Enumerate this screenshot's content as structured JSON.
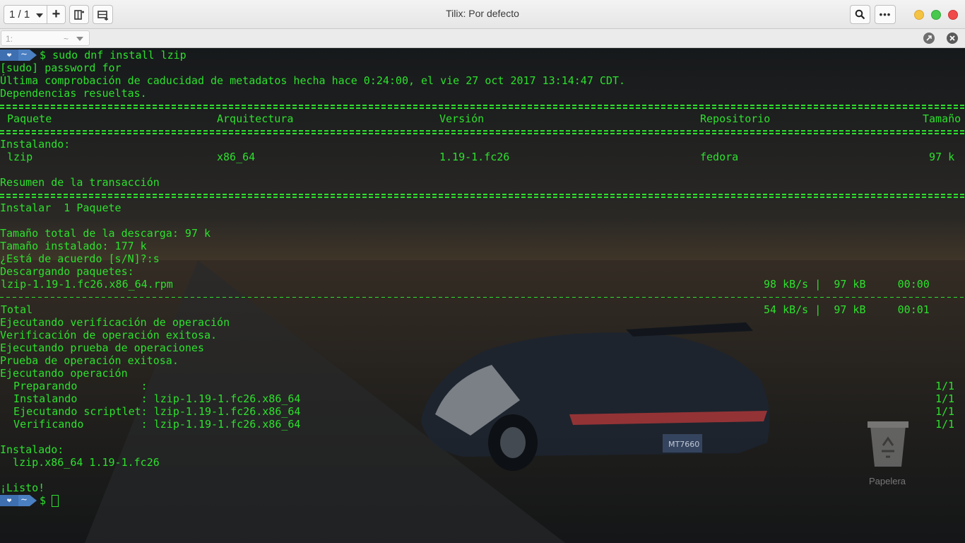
{
  "titlebar": {
    "session_label": "1 / 1",
    "add_label": "+",
    "window_title": "Tilix: Por defecto",
    "menu_label": "•••"
  },
  "terminal_bar": {
    "terminal_number": "1:",
    "terminal_path": "~"
  },
  "prompt": {
    "heart": "❤",
    "path": "~",
    "symbol": "$"
  },
  "output": {
    "cmd1": "sudo dnf install lzip",
    "l_sudo": "[sudo] password for",
    "l_meta": "Última comprobación de caducidad de metadatos hecha hace 0:24:00, el vie 27 oct 2017 13:14:47 CDT.",
    "l_deps": "Dependencias resueltas.",
    "h_pkg": " Paquete",
    "h_arch": "Arquitectura",
    "h_ver": "Versión",
    "h_repo": "Repositorio",
    "h_size": "Tamaño",
    "l_installing": "Instalando:",
    "r_pkg": " lzip",
    "r_arch": "x86_64",
    "r_ver": "1.19-1.fc26",
    "r_repo": "fedora",
    "r_size": "97 k",
    "l_summary": "Resumen de la transacción",
    "l_install1": "Instalar  1 Paquete",
    "l_dl_total": "Tamaño total de la descarga: 97 k",
    "l_installed_size": "Tamaño instalado: 177 k",
    "l_agree": "¿Está de acuerdo [s/N]?:s",
    "l_downloading": "Descargando paquetes:",
    "dl_file": "lzip-1.19-1.fc26.x86_64.rpm",
    "dl_stats": "98 kB/s |  97 kB     00:00",
    "total_label": "Total",
    "total_stats": "54 kB/s |  97 kB     00:01",
    "l_verif_run": "Ejecutando verificación de operación",
    "l_verif_ok": "Verificación de operación exitosa.",
    "l_test_run": "Ejecutando prueba de operaciones",
    "l_test_ok": "Prueba de operación exitosa.",
    "l_op_run": "Ejecutando operación",
    "s_prep": "  Preparando          :",
    "s_inst": "  Instalando          : lzip-1.19-1.fc26.x86_64",
    "s_script": "  Ejecutando scriptlet: lzip-1.19-1.fc26.x86_64",
    "s_verif": "  Verificando         : lzip-1.19-1.fc26.x86_64",
    "s_progress": "1/1",
    "l_installed": "Instalado:",
    "l_installed_pkg": "  lzip.x86_64 1.19-1.fc26",
    "l_done": "¡Listo!"
  },
  "desktop": {
    "trash_label": "Papelera",
    "plate": "MT7660"
  }
}
